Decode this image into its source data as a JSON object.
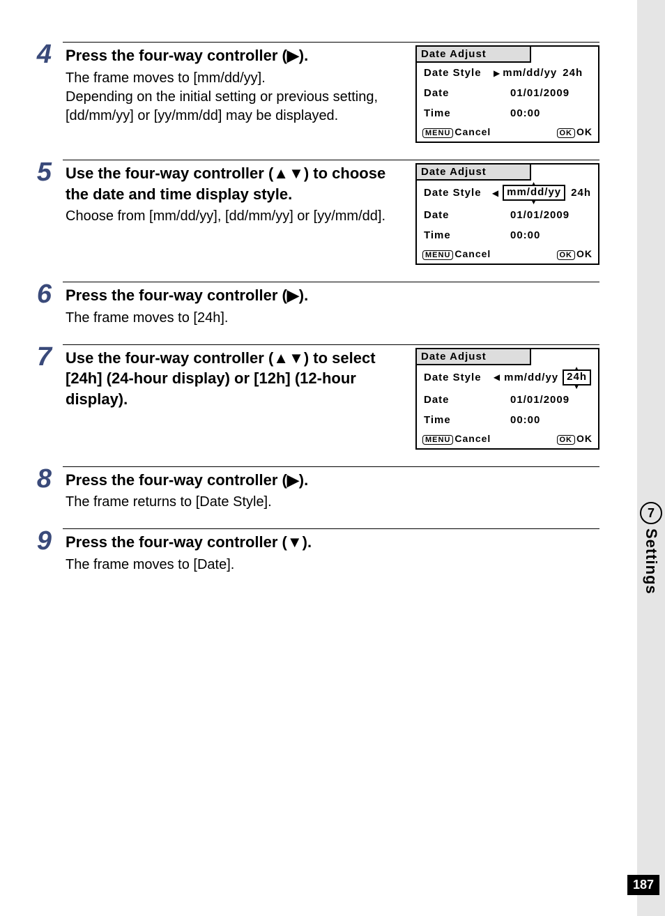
{
  "page_number": "187",
  "side_tab": {
    "num": "7",
    "label": "Settings"
  },
  "glyphs": {
    "right": "▶",
    "left": "◀",
    "up": "▲",
    "down": "▼"
  },
  "steps": {
    "s4": {
      "num": "4",
      "head_a": "Press the four-way controller (",
      "head_b": ").",
      "desc": "The frame moves to [mm/dd/yy].\nDepending on the initial setting or previous setting, [dd/mm/yy] or [yy/mm/dd] may be displayed."
    },
    "s5": {
      "num": "5",
      "head_a": "Use the four-way controller (",
      "head_b": ") to choose the date and time display style.",
      "desc": "Choose from [mm/dd/yy], [dd/mm/yy] or [yy/mm/dd]."
    },
    "s6": {
      "num": "6",
      "head_a": "Press the four-way controller (",
      "head_b": ").",
      "desc": "The frame moves to [24h]."
    },
    "s7": {
      "num": "7",
      "head_a": "Use the four-way controller (",
      "head_b": ") to select [24h] (24-hour display) or [12h] (12-hour display)."
    },
    "s8": {
      "num": "8",
      "head_a": "Press the four-way controller (",
      "head_b": ").",
      "desc": "The frame returns to [Date Style]."
    },
    "s9": {
      "num": "9",
      "head_a": "Press the four-way controller (",
      "head_b": ").",
      "desc": "The frame moves to [Date]."
    }
  },
  "lcd": {
    "title": "Date Adjust",
    "row1_label": "Date Style",
    "row2_label": "Date",
    "row3_label": "Time",
    "date_style_fmt": "mm/dd/yy",
    "date_style_24h": "24h",
    "date_value": "01/01/2009",
    "time_value": "00:00",
    "menu_label": "MENU",
    "cancel": "Cancel",
    "ok_label": "OK",
    "ok": "OK"
  }
}
